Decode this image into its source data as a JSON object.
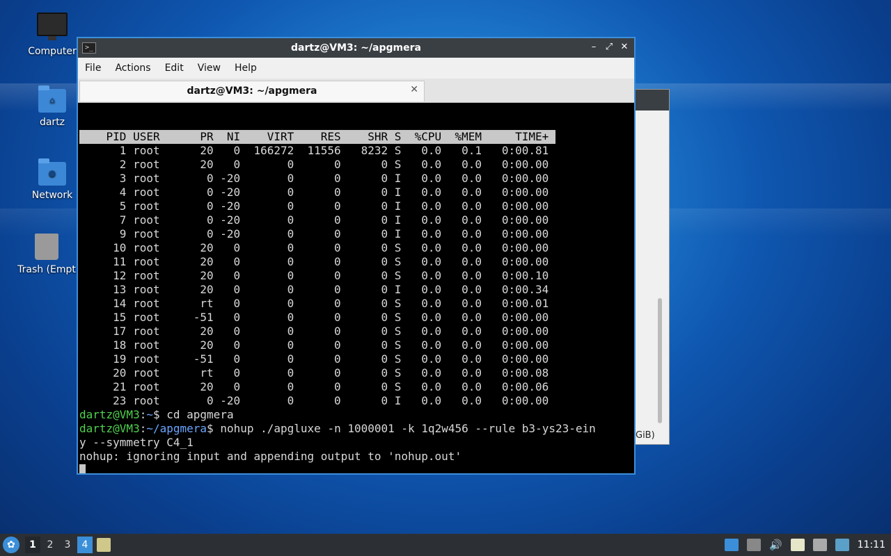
{
  "desktop": {
    "icons": [
      {
        "label": "Computer"
      },
      {
        "label": "dartz"
      },
      {
        "label": "Network"
      },
      {
        "label": "Trash (Empt"
      }
    ],
    "background_window_fragment": "GiB)"
  },
  "terminal": {
    "title": "dartz@VM3: ~/apgmera",
    "menu": [
      "File",
      "Actions",
      "Edit",
      "View",
      "Help"
    ],
    "tab_title": "dartz@VM3: ~/apgmera",
    "top_header": "    PID USER      PR  NI    VIRT    RES    SHR S  %CPU  %MEM     TIME+ ",
    "processes": [
      "      1 root      20   0  166272  11556   8232 S   0.0   0.1   0:00.81",
      "      2 root      20   0       0      0      0 S   0.0   0.0   0:00.00",
      "      3 root       0 -20       0      0      0 I   0.0   0.0   0:00.00",
      "      4 root       0 -20       0      0      0 I   0.0   0.0   0:00.00",
      "      5 root       0 -20       0      0      0 I   0.0   0.0   0:00.00",
      "      7 root       0 -20       0      0      0 I   0.0   0.0   0:00.00",
      "      9 root       0 -20       0      0      0 I   0.0   0.0   0:00.00",
      "     10 root      20   0       0      0      0 S   0.0   0.0   0:00.00",
      "     11 root      20   0       0      0      0 S   0.0   0.0   0:00.00",
      "     12 root      20   0       0      0      0 S   0.0   0.0   0:00.10",
      "     13 root      20   0       0      0      0 I   0.0   0.0   0:00.34",
      "     14 root      rt   0       0      0      0 S   0.0   0.0   0:00.01",
      "     15 root     -51   0       0      0      0 S   0.0   0.0   0:00.00",
      "     17 root      20   0       0      0      0 S   0.0   0.0   0:00.00",
      "     18 root      20   0       0      0      0 S   0.0   0.0   0:00.00",
      "     19 root     -51   0       0      0      0 S   0.0   0.0   0:00.00",
      "     20 root      rt   0       0      0      0 S   0.0   0.0   0:00.08",
      "     21 root      20   0       0      0      0 S   0.0   0.0   0:00.06",
      "     23 root       0 -20       0      0      0 I   0.0   0.0   0:00.00"
    ],
    "prompt1_user": "dartz@VM3",
    "prompt1_sep": ":",
    "prompt1_path": "~",
    "prompt1_rest": "$ cd apgmera",
    "prompt2_user": "dartz@VM3",
    "prompt2_sep": ":",
    "prompt2_path": "~/apgmera",
    "prompt2_rest": "$ nohup ./apgluxe -n 1000001 -k 1q2w456 --rule b3-ys23-ein",
    "wrap_line": "y --symmetry C4_1",
    "output_line": "nohup: ignoring input and appending output to 'nohup.out'"
  },
  "taskbar": {
    "workspaces": [
      "1",
      "2",
      "3",
      "4"
    ],
    "clock": "11:11"
  },
  "colors": {
    "accent": "#3b8fd9",
    "prompt_user": "#4fd14f",
    "prompt_path": "#6aa6ff"
  }
}
